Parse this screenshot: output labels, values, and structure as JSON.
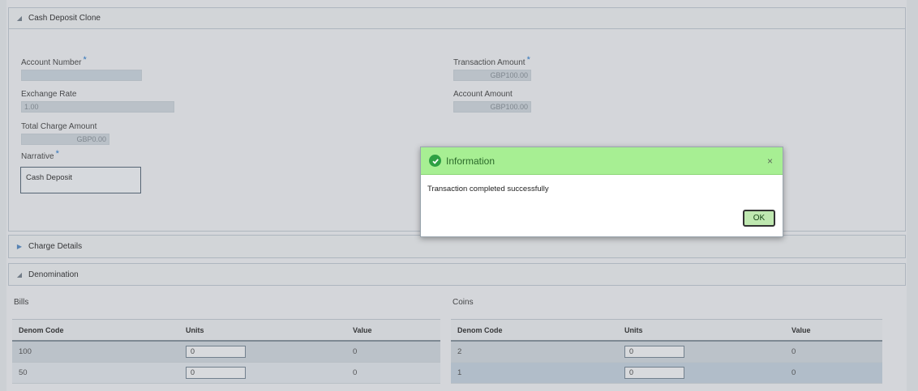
{
  "sections": {
    "cash_deposit": "Cash Deposit Clone",
    "charge_details": "Charge Details",
    "denomination": "Denomination"
  },
  "form": {
    "account_number_label": "Account Number",
    "account_number_value": "",
    "exchange_rate_label": "Exchange Rate",
    "exchange_rate_value": "1.00",
    "total_charge_label": "Total Charge Amount",
    "total_charge_value": "GBP0.00",
    "narrative_label": "Narrative",
    "narrative_value": "Cash Deposit",
    "transaction_amount_label": "Transaction Amount",
    "transaction_amount_value": "GBP100.00",
    "account_amount_label": "Account Amount",
    "account_amount_value": "GBP100.00",
    "required_mark": "*"
  },
  "bills": {
    "title": "Bills",
    "headers": [
      "Denom Code",
      "Units",
      "Value"
    ],
    "rows": [
      {
        "code": "100",
        "units": "0",
        "value": "0"
      },
      {
        "code": "50",
        "units": "0",
        "value": "0"
      }
    ]
  },
  "coins": {
    "title": "Coins",
    "headers": [
      "Denom Code",
      "Units",
      "Value"
    ],
    "rows": [
      {
        "code": "2",
        "units": "0",
        "value": "0"
      },
      {
        "code": "1",
        "units": "0",
        "value": "0"
      }
    ]
  },
  "dialog": {
    "title": "Information",
    "message": "Transaction completed successfully",
    "ok_label": "OK",
    "close_icon": "×",
    "header_color": "#a7ef93"
  }
}
